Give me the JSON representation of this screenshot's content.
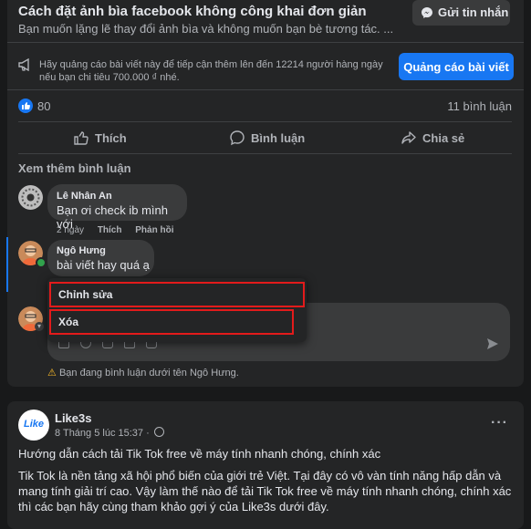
{
  "header": {
    "title": "Cách đặt ảnh bìa facebook không công khai đơn giản",
    "description": "Bạn muốn lặng lẽ thay đổi ảnh bìa và không muốn bạn bè tương tác. ...",
    "message_button": "Gửi tin nhắn"
  },
  "promo": {
    "text": "Hãy quảng cáo bài viết này để tiếp cận thêm lên đến 12214 người hàng ngày nếu bạn chi tiêu 700.000 ₫ nhé.",
    "button": "Quảng cáo bài viết"
  },
  "stats": {
    "likes": "80",
    "comments": "11 bình luận"
  },
  "actions": {
    "like": "Thích",
    "comment": "Bình luận",
    "share": "Chia sẻ"
  },
  "comments_section": {
    "more_label": "Xem thêm bình luận",
    "comments": [
      {
        "author": "Lê Nhân An",
        "text": "Bạn ơi check ib mình với",
        "time": "2 ngày",
        "like": "Thích",
        "reply": "Phản hồi"
      },
      {
        "author": "Ngô Hưng",
        "text": "bài viết hay quá ạ"
      }
    ]
  },
  "context_menu": {
    "edit": "Chỉnh sửa",
    "delete": "Xóa"
  },
  "composer": {
    "warning": "Bạn đang bình luận dưới tên Ngô Hưng."
  },
  "post2": {
    "author": "Like3s",
    "logo_text": "Like",
    "date": "8 Tháng 5 lúc 15:37 ·",
    "headline": "Hướng dẫn cách tải Tik Tok free về máy tính nhanh chóng, chính xác",
    "body": "Tik Tok là nền tảng xã hội phổ biến của giới trẻ Việt. Tại đây có vô vàn tính năng hấp dẫn và mang tính giải trí cao. Vậy làm thế nào để tải Tik Tok free về máy tính nhanh chóng, chính xác thì các bạn hãy cùng tham khảo gợi ý của Like3s dưới đây."
  },
  "colors": {
    "accent": "#1877f2",
    "highlight": "#e31b1b",
    "background": "#18191a",
    "card": "#242526"
  }
}
